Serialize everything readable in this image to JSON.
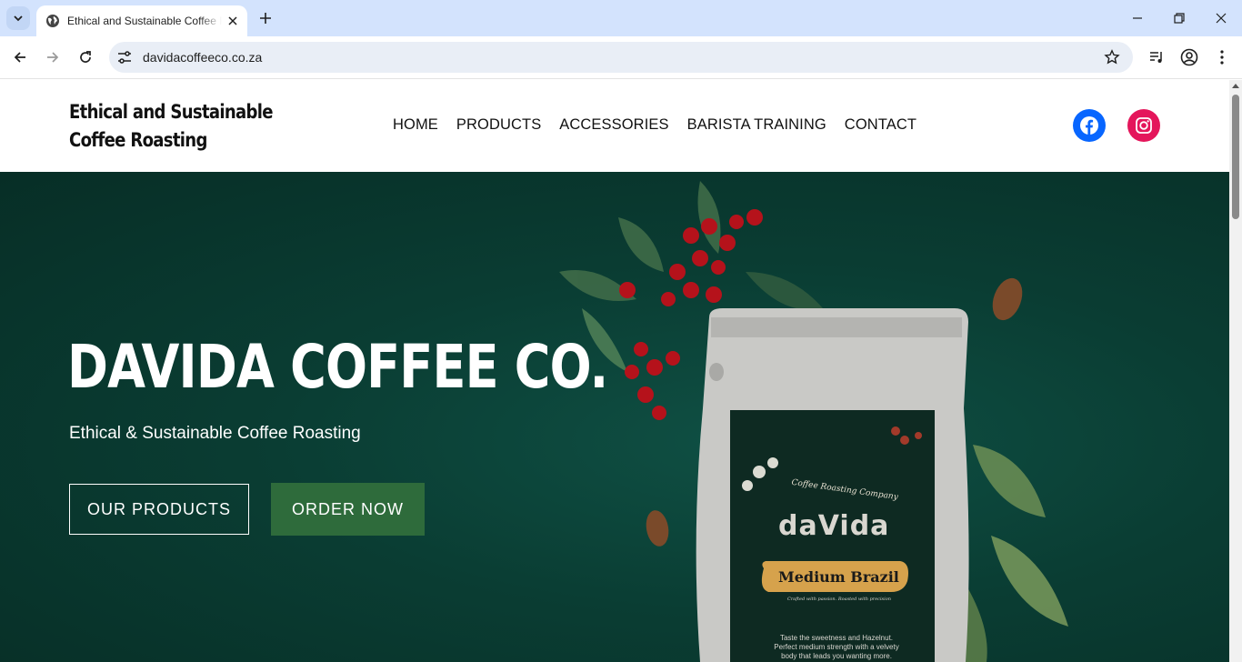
{
  "browser": {
    "tab_title": "Ethical and Sustainable Coffee Roasting",
    "url": "davidacoffeeco.co.za"
  },
  "site": {
    "title": "Ethical and Sustainable Coffee Roasting",
    "menu": [
      "HOME",
      "PRODUCTS",
      "ACCESSORIES",
      "BARISTA TRAINING",
      "CONTACT"
    ],
    "social": [
      {
        "name": "facebook-icon",
        "color": "#0866ff"
      },
      {
        "name": "instagram-icon",
        "color": "#e4165b"
      }
    ]
  },
  "hero": {
    "title": "DAVIDA COFFEE CO.",
    "subtitle": "Ethical & Sustainable Coffee Roasting",
    "btn_products": "OUR PRODUCTS",
    "btn_order": "ORDER NOW",
    "background_color": "#0a3d33",
    "order_button_color": "#2e6b3b"
  },
  "product_bag": {
    "arc_text": "Coffee Roasting Company",
    "brand": "daVida",
    "label": "Medium Brazil",
    "tagline": "Crafted with passion. Roasted with precision",
    "desc_line1": "Taste the sweetness and Hazelnut.",
    "desc_line2": "Perfect medium strength with a velvety",
    "desc_line3": "body that leads you wanting more."
  }
}
